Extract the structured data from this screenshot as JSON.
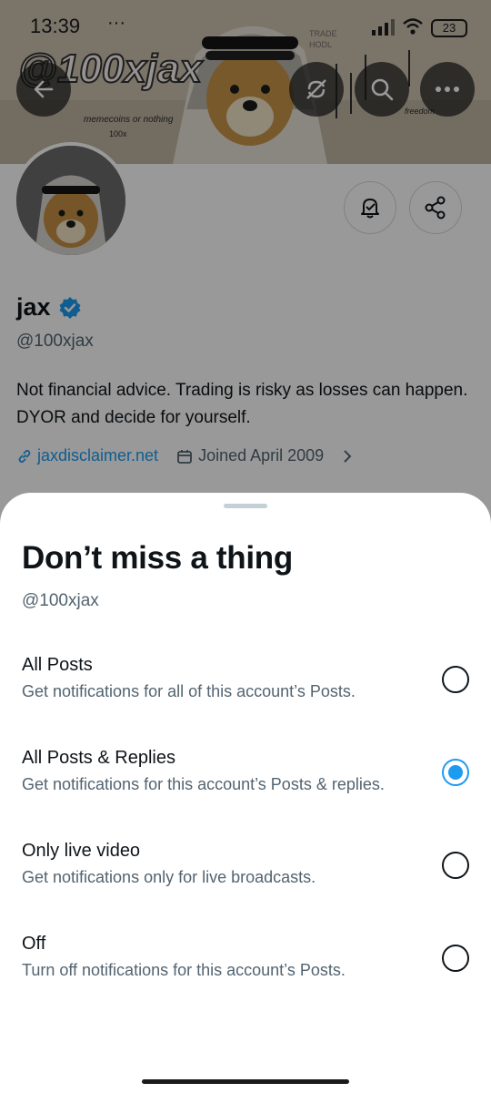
{
  "status_bar": {
    "time": "13:39",
    "dots": "···",
    "battery": "23"
  },
  "banner": {
    "handle_text": "@100xjax",
    "caption": "memecoins or nothing",
    "caption2": "100x",
    "right_text": "freedom"
  },
  "profile": {
    "name": "jax",
    "handle": "@100xjax",
    "bio": "Not financial advice. Trading is risky as losses can happen. DYOR and decide for yourself.",
    "website": "jaxdisclaimer.net",
    "joined": "Joined April 2009"
  },
  "sheet": {
    "title": "Don’t miss a thing",
    "handle": "@100xjax",
    "options": [
      {
        "title": "All Posts",
        "description": "Get notifications for all of this account’s Posts.",
        "selected": false
      },
      {
        "title": "All Posts & Replies",
        "description": "Get notifications for this account’s Posts & replies.",
        "selected": true
      },
      {
        "title": "Only live video",
        "description": "Get notifications only for live broadcasts.",
        "selected": false
      },
      {
        "title": "Off",
        "description": "Turn off notifications for this account’s Posts.",
        "selected": false
      }
    ]
  },
  "colors": {
    "accent": "#1d9bf0",
    "text_primary": "#0f1419",
    "text_secondary": "#536471",
    "scrim": "rgba(0,0,0,0.40)"
  },
  "icons": [
    "back-arrow-icon",
    "no-repost-icon",
    "search-icon",
    "more-icon",
    "notification-bell-icon",
    "share-icon",
    "verified-badge-icon",
    "link-icon",
    "calendar-icon",
    "chevron-right-icon"
  ]
}
